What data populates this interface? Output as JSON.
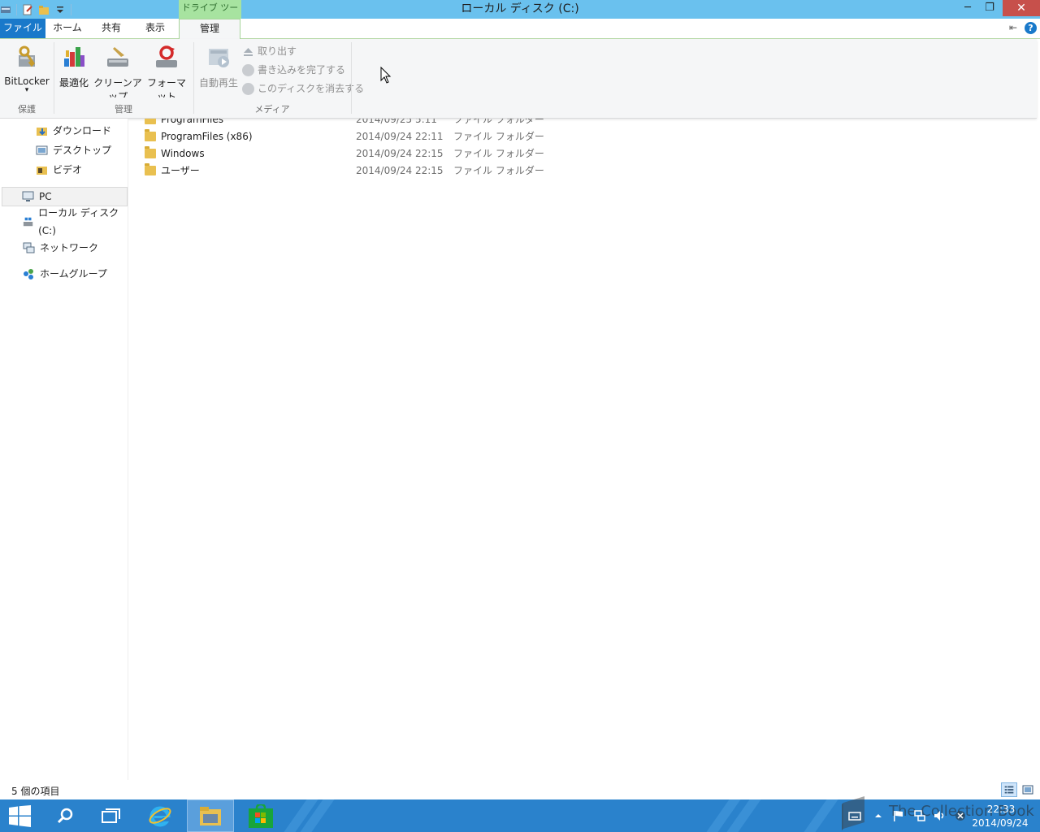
{
  "window": {
    "title": "ローカル ディスク (C:)",
    "context_tab_label": "ドライブ ツール",
    "controls": {
      "minimize": "─",
      "restore": "❐",
      "close": "✕"
    }
  },
  "ribbon_tabs": [
    "ファイル",
    "ホーム",
    "共有",
    "表示",
    "管理"
  ],
  "ribbon": {
    "groups": [
      {
        "label": "保護",
        "buttons": [
          "BitLocker"
        ]
      },
      {
        "label": "管理",
        "buttons": [
          "最適化",
          "クリーンアップ",
          "フォーマット"
        ]
      },
      {
        "label": "メディア",
        "buttons": [
          "自動再生"
        ],
        "small_buttons": [
          "取り出す",
          "書き込みを完了する",
          "このディスクを消去する"
        ]
      }
    ],
    "bitlocker_dropdown": "▾",
    "pin_icon": "⇤",
    "help_icon": "?"
  },
  "nav": {
    "items": [
      {
        "label": "ダウンロード",
        "icon": "downloads-folder-icon"
      },
      {
        "label": "デスクトップ",
        "icon": "desktop-folder-icon"
      },
      {
        "label": "ビデオ",
        "icon": "videos-folder-icon"
      },
      {
        "label": "PC",
        "icon": "pc-icon",
        "selected": true
      },
      {
        "label": "ローカル ディスク (C:)",
        "icon": "local-disk-icon"
      },
      {
        "label": "ネットワーク",
        "icon": "network-icon"
      },
      {
        "label": "ホームグループ",
        "icon": "homegroup-icon"
      }
    ]
  },
  "files": [
    {
      "name": "ProgramFiles",
      "date": "2014/09/25 5:11",
      "type": "ファイル フォルダー"
    },
    {
      "name": "ProgramFiles (x86)",
      "date": "2014/09/24 22:11",
      "type": "ファイル フォルダー"
    },
    {
      "name": "Windows",
      "date": "2014/09/24 22:15",
      "type": "ファイル フォルダー"
    },
    {
      "name": "ユーザー",
      "date": "2014/09/24 22:15",
      "type": "ファイル フォルダー"
    }
  ],
  "status": {
    "item_count": "5 個の項目"
  },
  "taskbar": {
    "time": "22:33",
    "date": "2014/09/24",
    "watermark": "The Collection Book"
  }
}
